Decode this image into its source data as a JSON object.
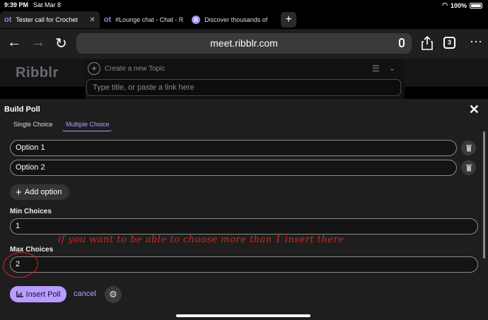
{
  "status": {
    "time": "9:39 PM",
    "date": "Sat Mar 8",
    "battery": "100%"
  },
  "tabs": [
    {
      "icon": "ot",
      "title": "Tester call for Crochet",
      "active": true
    },
    {
      "icon": "ot",
      "title": "#Lounge chat - Chat - R",
      "active": false
    },
    {
      "icon": "R",
      "title": "Discover thousands of",
      "active": false
    }
  ],
  "toolbar": {
    "url": "meet.ribblr.com",
    "tab_count": "3"
  },
  "site": {
    "logo": "Ribblr"
  },
  "composer": {
    "label": "Create a new Topic",
    "placeholder": "Type title, or paste a link here"
  },
  "modal": {
    "title": "Build Poll",
    "seg_single": "Single Choice",
    "seg_multi": "Multiple Choice",
    "options": [
      "Option 1",
      "Option 2"
    ],
    "add_option": "Add option",
    "min_label": "Min Choices",
    "min_value": "1",
    "max_label": "Max Choices",
    "max_value": "2",
    "insert": "Insert Poll",
    "cancel": "cancel"
  },
  "annotation": {
    "text": "if you want to be able to choose more than 1 insert there",
    "color": "#d22222"
  }
}
